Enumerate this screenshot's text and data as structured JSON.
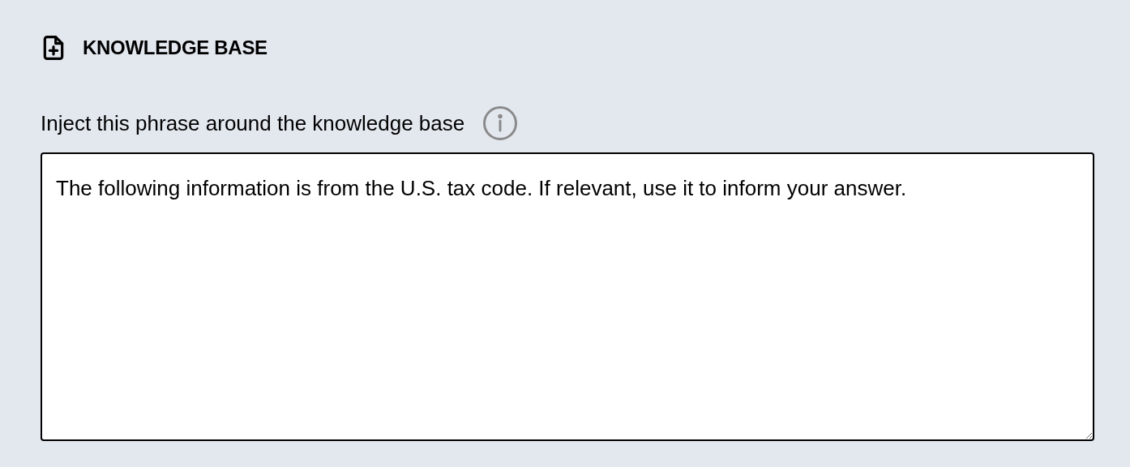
{
  "section": {
    "title": "KNOWLEDGE BASE"
  },
  "field": {
    "label": "Inject this phrase around the knowledge base",
    "value": "The following information is from the U.S. tax code. If relevant, use it to inform your answer."
  }
}
